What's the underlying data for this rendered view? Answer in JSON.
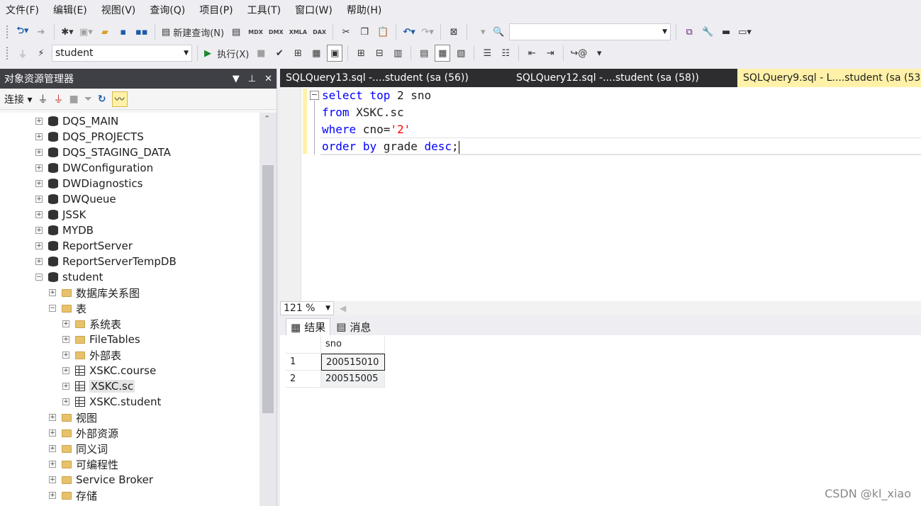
{
  "menu": [
    "文件(F)",
    "编辑(E)",
    "视图(V)",
    "查询(Q)",
    "项目(P)",
    "工具(T)",
    "窗口(W)",
    "帮助(H)"
  ],
  "toolbar1": {
    "new_query": "新建查询(N)",
    "mdx": "MDX",
    "dmx": "DMX",
    "xmla": "XMLA",
    "dax": "DAX",
    "search_value": ""
  },
  "toolbar2": {
    "database": "student",
    "execute": "执行(X)"
  },
  "object_explorer": {
    "title": "对象资源管理器",
    "connect": "连接",
    "tree": [
      {
        "label": "DQS_MAIN",
        "icon": "database-icon",
        "level": 0,
        "expander": "+"
      },
      {
        "label": "DQS_PROJECTS",
        "icon": "database-icon",
        "level": 0,
        "expander": "+"
      },
      {
        "label": "DQS_STAGING_DATA",
        "icon": "database-icon",
        "level": 0,
        "expander": "+"
      },
      {
        "label": "DWConfiguration",
        "icon": "database-icon",
        "level": 0,
        "expander": "+"
      },
      {
        "label": "DWDiagnostics",
        "icon": "database-icon",
        "level": 0,
        "expander": "+"
      },
      {
        "label": "DWQueue",
        "icon": "database-icon",
        "level": 0,
        "expander": "+"
      },
      {
        "label": "JSSK",
        "icon": "database-icon",
        "level": 0,
        "expander": "+"
      },
      {
        "label": "MYDB",
        "icon": "database-icon",
        "level": 0,
        "expander": "+"
      },
      {
        "label": "ReportServer",
        "icon": "database-icon",
        "level": 0,
        "expander": "+"
      },
      {
        "label": "ReportServerTempDB",
        "icon": "database-icon",
        "level": 0,
        "expander": "+"
      },
      {
        "label": "student",
        "icon": "database-icon",
        "level": 0,
        "expander": "−"
      },
      {
        "label": "数据库关系图",
        "icon": "folder-icon",
        "level": 1,
        "expander": "+"
      },
      {
        "label": "表",
        "icon": "folder-icon",
        "level": 1,
        "expander": "−"
      },
      {
        "label": "系统表",
        "icon": "folder-icon",
        "level": 2,
        "expander": "+"
      },
      {
        "label": "FileTables",
        "icon": "folder-icon",
        "level": 2,
        "expander": "+"
      },
      {
        "label": "外部表",
        "icon": "folder-icon",
        "level": 2,
        "expander": "+"
      },
      {
        "label": "XSKC.course",
        "icon": "table-icon",
        "level": 2,
        "expander": "+"
      },
      {
        "label": "XSKC.sc",
        "icon": "table-icon",
        "level": 2,
        "expander": "+",
        "selected": true
      },
      {
        "label": "XSKC.student",
        "icon": "table-icon",
        "level": 2,
        "expander": "+"
      },
      {
        "label": "视图",
        "icon": "folder-icon",
        "level": 1,
        "expander": "+"
      },
      {
        "label": "外部资源",
        "icon": "folder-icon",
        "level": 1,
        "expander": "+"
      },
      {
        "label": "同义词",
        "icon": "folder-icon",
        "level": 1,
        "expander": "+"
      },
      {
        "label": "可编程性",
        "icon": "folder-icon",
        "level": 1,
        "expander": "+"
      },
      {
        "label": "Service Broker",
        "icon": "folder-icon",
        "level": 1,
        "expander": "+"
      },
      {
        "label": "存储",
        "icon": "folder-icon",
        "level": 1,
        "expander": "+"
      }
    ]
  },
  "tabs": [
    {
      "label": "SQLQuery13.sql -....student (sa (56))",
      "active": false
    },
    {
      "label": "SQLQuery12.sql -....student (sa (58))",
      "active": false
    },
    {
      "label": "SQLQuery9.sql - L....student (sa (53",
      "active": true
    }
  ],
  "editor": {
    "lines": [
      [
        {
          "t": "select",
          "c": "kw"
        },
        {
          "t": " ",
          "c": "plain"
        },
        {
          "t": "top",
          "c": "kw"
        },
        {
          "t": " 2 sno",
          "c": "plain"
        }
      ],
      [
        {
          "t": "from",
          "c": "kw"
        },
        {
          "t": " XSKC.sc",
          "c": "plain"
        }
      ],
      [
        {
          "t": "where",
          "c": "kw"
        },
        {
          "t": " cno=",
          "c": "plain"
        },
        {
          "t": "'2'",
          "c": "str"
        }
      ],
      [
        {
          "t": "order",
          "c": "kw"
        },
        {
          "t": " ",
          "c": "plain"
        },
        {
          "t": "by",
          "c": "kw"
        },
        {
          "t": " grade ",
          "c": "plain"
        },
        {
          "t": "desc",
          "c": "kw"
        },
        {
          "t": ";",
          "c": "plain"
        }
      ]
    ],
    "zoom": "121 %"
  },
  "results": {
    "tab_results": "结果",
    "tab_messages": "消息",
    "columns": [
      "sno"
    ],
    "rows": [
      {
        "num": "1",
        "sno": "200515010"
      },
      {
        "num": "2",
        "sno": "200515005"
      }
    ]
  },
  "watermark": "CSDN @kl_xiao"
}
